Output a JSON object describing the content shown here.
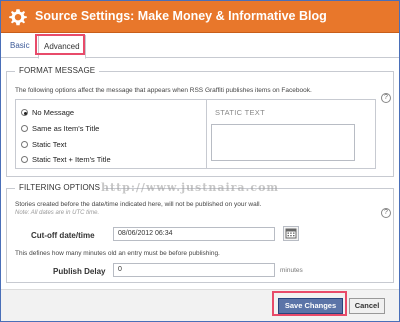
{
  "window": {
    "title": "Source Settings: Make Money & Informative Blog",
    "icon": "gear-icon",
    "accent_color": "#e8772b"
  },
  "tabs": [
    {
      "label": "Basic",
      "active": false
    },
    {
      "label": "Advanced",
      "active": true
    }
  ],
  "format_message": {
    "legend": "FORMAT MESSAGE",
    "description": "The following options affect the message that appears when RSS Graffiti publishes items on Facebook.",
    "options": [
      {
        "label": "No Message",
        "selected": true
      },
      {
        "label": "Same as Item's Title",
        "selected": false
      },
      {
        "label": "Static Text",
        "selected": false
      },
      {
        "label": "Static Text + Item's Title",
        "selected": false
      }
    ],
    "static_text_label": "STATIC TEXT",
    "static_text_value": ""
  },
  "filtering": {
    "legend": "FILTERING OPTIONS",
    "description": "Stories created before the date/time indicated here, will not be published on your wall.",
    "note": "Note: All dates are in UTC time.",
    "cutoff_label": "Cut-off date/time",
    "cutoff_value": "08/06/2012 06:34",
    "delay_description": "This defines how many minutes old an entry must be before publishing.",
    "delay_label": "Publish Delay",
    "delay_value": "0",
    "delay_unit": "minutes"
  },
  "footer": {
    "save_label": "Save Changes",
    "cancel_label": "Cancel"
  },
  "help_glyph": "?",
  "watermark": "http://www.justnaira.com"
}
